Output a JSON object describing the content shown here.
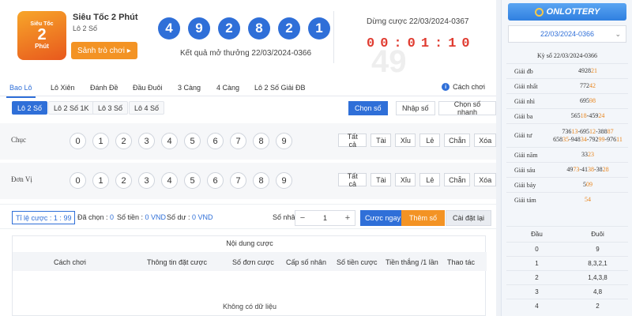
{
  "header": {
    "logo_text_top": "Siêu Tốc",
    "logo_text_mid": "2",
    "logo_text_bot": "Phút",
    "game_name": "Siêu Tốc 2 Phút",
    "game_sub": "Lô 2 Số",
    "lobby_label": "Sảnh trò chơi ▸",
    "result_balls": [
      "4",
      "9",
      "2",
      "8",
      "2",
      "1"
    ],
    "result_label": "Kết quả mở thưởng 22/03/2024-0366",
    "stop_label": "Dừng cược 22/03/2024-0367",
    "countdown": [
      "0",
      "0",
      ":",
      "0",
      "1",
      ":",
      "1",
      "0"
    ]
  },
  "tabs": [
    "Bao Lô",
    "Lô Xiên",
    "Đánh Đề",
    "Đầu Đuôi",
    "3 Càng",
    "4 Càng",
    "Lô 2 Số Giải ĐB"
  ],
  "rules_label": "Cách chơi",
  "subtabs": [
    "Lô 2 Số",
    "Lô 2 Số 1K",
    "Lô 3 Số",
    "Lô 4 Số"
  ],
  "modes": [
    "Chọn số",
    "Nhập số",
    "Chọn số nhanh"
  ],
  "rows": [
    {
      "label": "Chục"
    },
    {
      "label": "Đơn Vị"
    }
  ],
  "digits": [
    "0",
    "1",
    "2",
    "3",
    "4",
    "5",
    "6",
    "7",
    "8",
    "9"
  ],
  "quick": [
    "Tất cả",
    "Tài",
    "Xỉu",
    "Lẻ",
    "Chẵn",
    "Xóa"
  ],
  "bar": {
    "odds": "Tỉ lệ cược : 1 : 99",
    "chosen_label": "Đã chọn : ",
    "chosen_val": "0",
    "money_label": "Số tiền : ",
    "money_val": "0 VND",
    "balance_label": "Số dư : ",
    "balance_val": "0 VND",
    "mult_label": "Số nhân :",
    "minus": "−",
    "mult_val": "1",
    "plus": "+",
    "bet_now": "Cược ngay",
    "add_num": "Thêm số",
    "reset": "Cài đặt lại"
  },
  "table": {
    "title": "Nội dung cược",
    "headers": [
      "Cách chơi",
      "Thông tin đặt cược",
      "Số đơn cược",
      "Cấp số nhân",
      "Số tiền cược",
      "Tiền thắng /1 lần",
      "Thao tác"
    ],
    "empty": "Không có dữ liệu"
  },
  "right": {
    "brand": "ONLOTTERY",
    "date": "22/03/2024-0366",
    "title": "Kỳ số 22/03/2024-0366",
    "prizes": [
      {
        "name": "Giải đb",
        "parts": [
          [
            "4928",
            0
          ],
          [
            "21",
            1
          ]
        ]
      },
      {
        "name": "Giải nhất",
        "parts": [
          [
            "772",
            0
          ],
          [
            "42",
            1
          ]
        ]
      },
      {
        "name": "Giải nhì",
        "parts": [
          [
            "695",
            0
          ],
          [
            "98",
            1
          ]
        ]
      },
      {
        "name": "Giải ba",
        "parts": [
          [
            "565",
            0
          ],
          [
            "18",
            1
          ],
          [
            "-459",
            0
          ],
          [
            "24",
            1
          ]
        ]
      },
      {
        "name": "Giải tư",
        "parts": [
          [
            "736",
            0
          ],
          [
            "13",
            1
          ],
          [
            "-695",
            0
          ],
          [
            "12",
            1
          ],
          [
            "-388",
            0
          ],
          [
            "87",
            1
          ],
          [
            "\n658",
            0
          ],
          [
            "35",
            1
          ],
          [
            "-948",
            0
          ],
          [
            "34",
            1
          ],
          [
            "-792",
            0
          ],
          [
            "99",
            1
          ],
          [
            "-976",
            0
          ],
          [
            "11",
            1
          ]
        ]
      },
      {
        "name": "Giải năm",
        "parts": [
          [
            "33",
            0
          ],
          [
            "23",
            1
          ]
        ]
      },
      {
        "name": "Giải sáu",
        "parts": [
          [
            "49",
            0
          ],
          [
            "73",
            1
          ],
          [
            "-41",
            0
          ],
          [
            "38",
            1
          ],
          [
            "-38",
            0
          ],
          [
            "28",
            1
          ]
        ]
      },
      {
        "name": "Giải bảy",
        "parts": [
          [
            "5",
            0
          ],
          [
            "09",
            1
          ]
        ]
      },
      {
        "name": "Giải tám",
        "parts": [
          [
            "54",
            1
          ]
        ]
      }
    ],
    "head_label": "Đầu",
    "tail_label": "Đuôi",
    "dd_rows": [
      {
        "d": "0",
        "t": "9"
      },
      {
        "d": "1",
        "t": "8,3,2,1"
      },
      {
        "d": "2",
        "t": "1,4,3,8"
      },
      {
        "d": "3",
        "t": "4,8"
      },
      {
        "d": "4",
        "t": "2"
      }
    ]
  },
  "colors": {
    "primary": "#2f6fd8",
    "accent": "#f39324",
    "timer": "#e03c31",
    "highlight": "#e8851d"
  }
}
